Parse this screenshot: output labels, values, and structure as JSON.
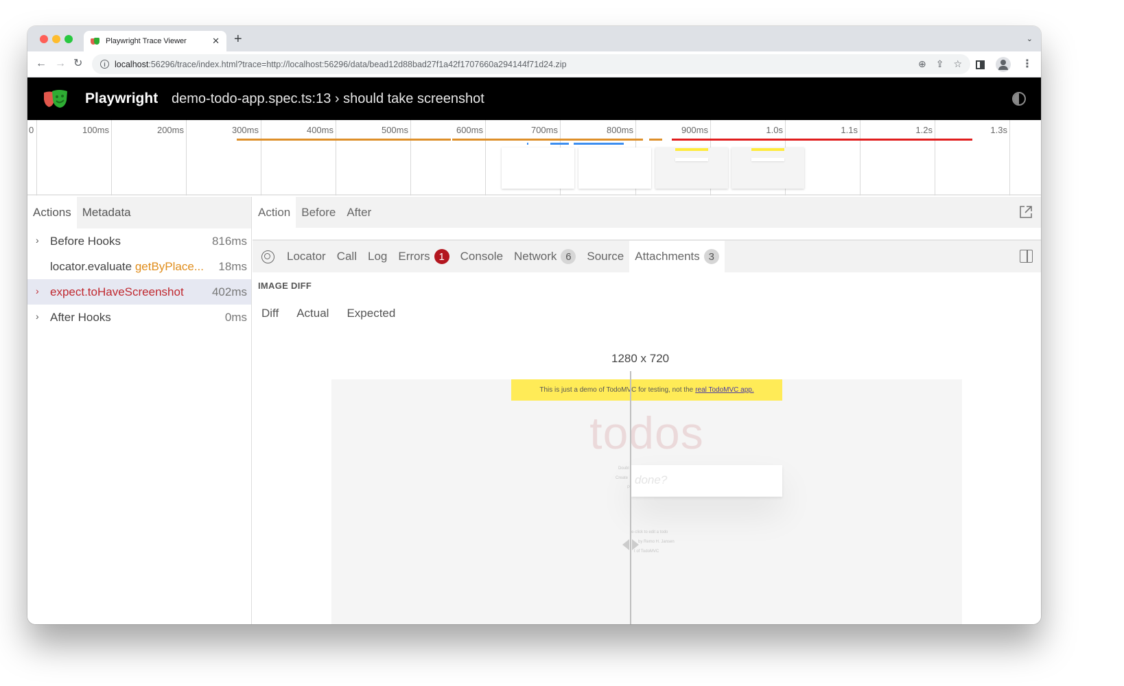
{
  "browser": {
    "tab_title": "Playwright Trace Viewer",
    "tab_close": "✕",
    "new_tab": "+",
    "tabstrip_menu": "⌄",
    "nav": {
      "back": "←",
      "forward": "→",
      "reload": "↻"
    },
    "url_host": "localhost",
    "url_rest": ":56296/trace/index.html?trace=http://localhost:56296/data/bead12d88bad27f1a42f1707660a294144f71d24.zip",
    "info_icon": "i",
    "omnibox_icons": {
      "zoom": "⊕",
      "share": "⇪",
      "bookmark": "☆"
    },
    "kebab": "⋮"
  },
  "header": {
    "brand": "Playwright",
    "title": "demo-todo-app.spec.ts:13 › should take screenshot"
  },
  "timeline": {
    "ticks": [
      "0",
      "100ms",
      "200ms",
      "300ms",
      "400ms",
      "500ms",
      "600ms",
      "700ms",
      "800ms",
      "900ms",
      "1.0s",
      "1.1s",
      "1.2s",
      "1.3s"
    ],
    "bar_colors": {
      "orange": "#de8f29",
      "blue": "#3c8ef0",
      "red": "#e01d1d"
    }
  },
  "actions_panel": {
    "tabs": [
      "Actions",
      "Metadata"
    ],
    "active_tab": "Actions",
    "items": [
      {
        "name": "Before Hooks",
        "selector": "",
        "duration": "816ms",
        "expandable": true,
        "selected": false
      },
      {
        "name": "locator.evaluate",
        "selector": "getByPlace...",
        "duration": "18ms",
        "expandable": false,
        "selected": false
      },
      {
        "name": "expect.toHaveScreenshot",
        "selector": "",
        "duration": "402ms",
        "expandable": true,
        "selected": true
      },
      {
        "name": "After Hooks",
        "selector": "",
        "duration": "0ms",
        "expandable": true,
        "selected": false
      }
    ]
  },
  "snapshot_tabs": {
    "tabs": [
      "Action",
      "Before",
      "After"
    ],
    "active_tab": "Action"
  },
  "detail_tabs": {
    "tabs": [
      {
        "label": "Locator",
        "badge": ""
      },
      {
        "label": "Call",
        "badge": ""
      },
      {
        "label": "Log",
        "badge": ""
      },
      {
        "label": "Errors",
        "badge": "1"
      },
      {
        "label": "Console",
        "badge": ""
      },
      {
        "label": "Network",
        "badge": "6"
      },
      {
        "label": "Source",
        "badge": ""
      },
      {
        "label": "Attachments",
        "badge": "3"
      }
    ],
    "active_tab": "Attachments"
  },
  "attachments": {
    "section_title": "IMAGE DIFF",
    "diff_tabs": [
      "Diff",
      "Actual",
      "Expected"
    ],
    "dimensions": "1280 x 720",
    "screenshot": {
      "banner_text": "This is just a demo of TodoMVC for testing, not the",
      "banner_link": "real TodoMVC app.",
      "app_title": "todos",
      "input_placeholder": "done?",
      "hints_left": [
        "Doubl",
        "Create",
        "P"
      ],
      "hints_right": [
        "e-click to edit a todo",
        "by Remo H. Jansen",
        "t of TodoMVC"
      ]
    }
  }
}
